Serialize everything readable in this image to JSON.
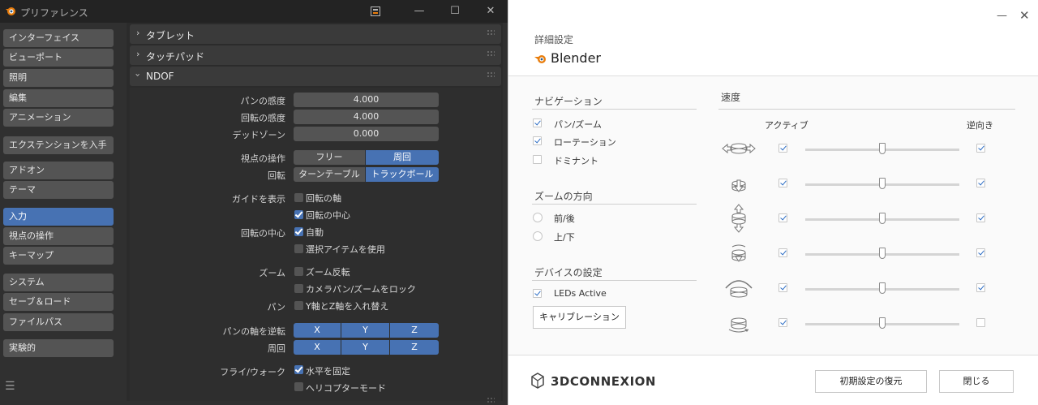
{
  "blender": {
    "title": "プリファレンス",
    "sidebar": [
      {
        "label": "インターフェイス",
        "state": "normal"
      },
      {
        "label": "ビューポート",
        "state": "normal"
      },
      {
        "label": "照明",
        "state": "normal"
      },
      {
        "label": "編集",
        "state": "normal"
      },
      {
        "label": "アニメーション",
        "state": "normal"
      },
      {
        "label": "エクステンションを入手",
        "state": "normal"
      },
      {
        "label": "アドオン",
        "state": "normal"
      },
      {
        "label": "テーマ",
        "state": "normal"
      },
      {
        "label": "入力",
        "state": "active"
      },
      {
        "label": "視点の操作",
        "state": "normal"
      },
      {
        "label": "キーマップ",
        "state": "normal"
      },
      {
        "label": "システム",
        "state": "normal"
      },
      {
        "label": "セーブ＆ロード",
        "state": "normal"
      },
      {
        "label": "ファイルパス",
        "state": "normal"
      },
      {
        "label": "実験的",
        "state": "normal"
      }
    ],
    "panels": {
      "tablet": "タブレット",
      "touchpad": "タッチパッド",
      "ndof": "NDOF"
    },
    "ndof": {
      "pan_sensitivity_label": "パンの感度",
      "pan_sensitivity_value": "4.000",
      "orbit_sensitivity_label": "回転の感度",
      "orbit_sensitivity_value": "4.000",
      "deadzone_label": "デッドゾーン",
      "deadzone_value": "0.000",
      "nav_mode_label": "視点の操作",
      "nav_mode_options": [
        "フリー",
        "周回"
      ],
      "rotation_label": "回転",
      "rotation_options": [
        "ターンテーブル",
        "トラックボール"
      ],
      "show_guides_label": "ガイドを表示",
      "show_orbit_axis": "回転の軸",
      "show_orbit_center": "回転の中心",
      "orbit_center_label": "回転の中心",
      "orbit_center_auto": "自動",
      "use_selection": "選択アイテムを使用",
      "zoom_label": "ズーム",
      "zoom_invert": "ズーム反転",
      "lock_camera": "カメラパン/ズームをロック",
      "pan_label": "パン",
      "swap_yz": "Y軸とZ軸を入れ替え",
      "invert_pan_label": "パンの軸を逆転",
      "orbit_label": "周回",
      "axes": [
        "X",
        "Y",
        "Z"
      ],
      "fly_label": "フライ/ウォーク",
      "lock_horizon": "水平を固定",
      "helicopter": "ヘリコプターモード"
    }
  },
  "tdx": {
    "subtitle": "詳細設定",
    "app_name": "Blender",
    "navigation_title": "ナビゲーション",
    "pan_zoom": "パン/ズーム",
    "rotation": "ローテーション",
    "dominant": "ドミナント",
    "zoom_direction_title": "ズームの方向",
    "zoom_fwd_back": "前/後",
    "zoom_up_down": "上/下",
    "device_settings_title": "デバイスの設定",
    "leds_active": "LEDs Active",
    "calibration_button": "キャリブレーション",
    "speed_title": "速度",
    "active_header": "アクティブ",
    "reverse_header": "逆向き",
    "axes": [
      {
        "icon": "pan-lr-icon",
        "active": true,
        "speed": 0.5,
        "reverse": true
      },
      {
        "icon": "pan-ud-icon",
        "active": true,
        "speed": 0.5,
        "reverse": true
      },
      {
        "icon": "zoom-icon",
        "active": true,
        "speed": 0.5,
        "reverse": true
      },
      {
        "icon": "tilt-icon",
        "active": true,
        "speed": 0.5,
        "reverse": true
      },
      {
        "icon": "roll-icon",
        "active": true,
        "speed": 0.5,
        "reverse": true
      },
      {
        "icon": "spin-icon",
        "active": true,
        "speed": 0.5,
        "reverse": false
      }
    ],
    "brand": "3DCONNEXION",
    "restore_defaults": "初期設定の復元",
    "close": "閉じる"
  }
}
